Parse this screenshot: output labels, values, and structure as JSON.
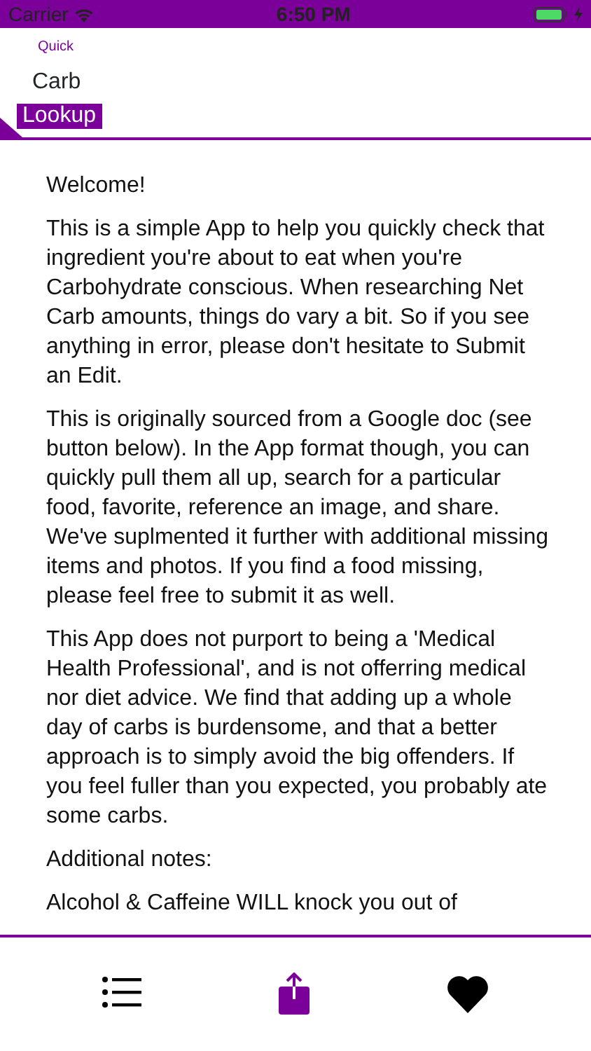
{
  "status_bar": {
    "carrier": "Carrier",
    "time": "6:50 PM"
  },
  "logo": {
    "line_1": "Quick",
    "line_2": "Carb",
    "line_3": "Lookup"
  },
  "paragraphs": [
    "Welcome!",
    "This is a simple App to help you quickly check that ingredient you're about to eat when you're Carbohydrate conscious. When researching Net Carb amounts, things do vary a bit. So if you see anything in error, please don't hesitate to Submit an Edit.",
    "This is originally sourced from a Google doc (see button below). In the App format though, you can quickly pull them all up, search for a particular food, favorite, reference an image, and share. We've suplmented it further with additional missing items and photos. If you find a food missing, please feel free to submit it as well.",
    "This App does not purport to being a 'Medical Health Professional', and is not offerring medical nor diet advice. We find that adding up a whole day of carbs is burdensome, and that a better approach is to simply avoid the big offenders. If you feel fuller than you expected, you probably ate some carbs.",
    "Additional notes:",
    "Alcohol & Caffeine WILL knock you out of"
  ],
  "tab_bar": [
    {
      "kind": "list",
      "selected": false
    },
    {
      "kind": "share",
      "selected": true
    },
    {
      "kind": "heart",
      "selected": false
    }
  ]
}
